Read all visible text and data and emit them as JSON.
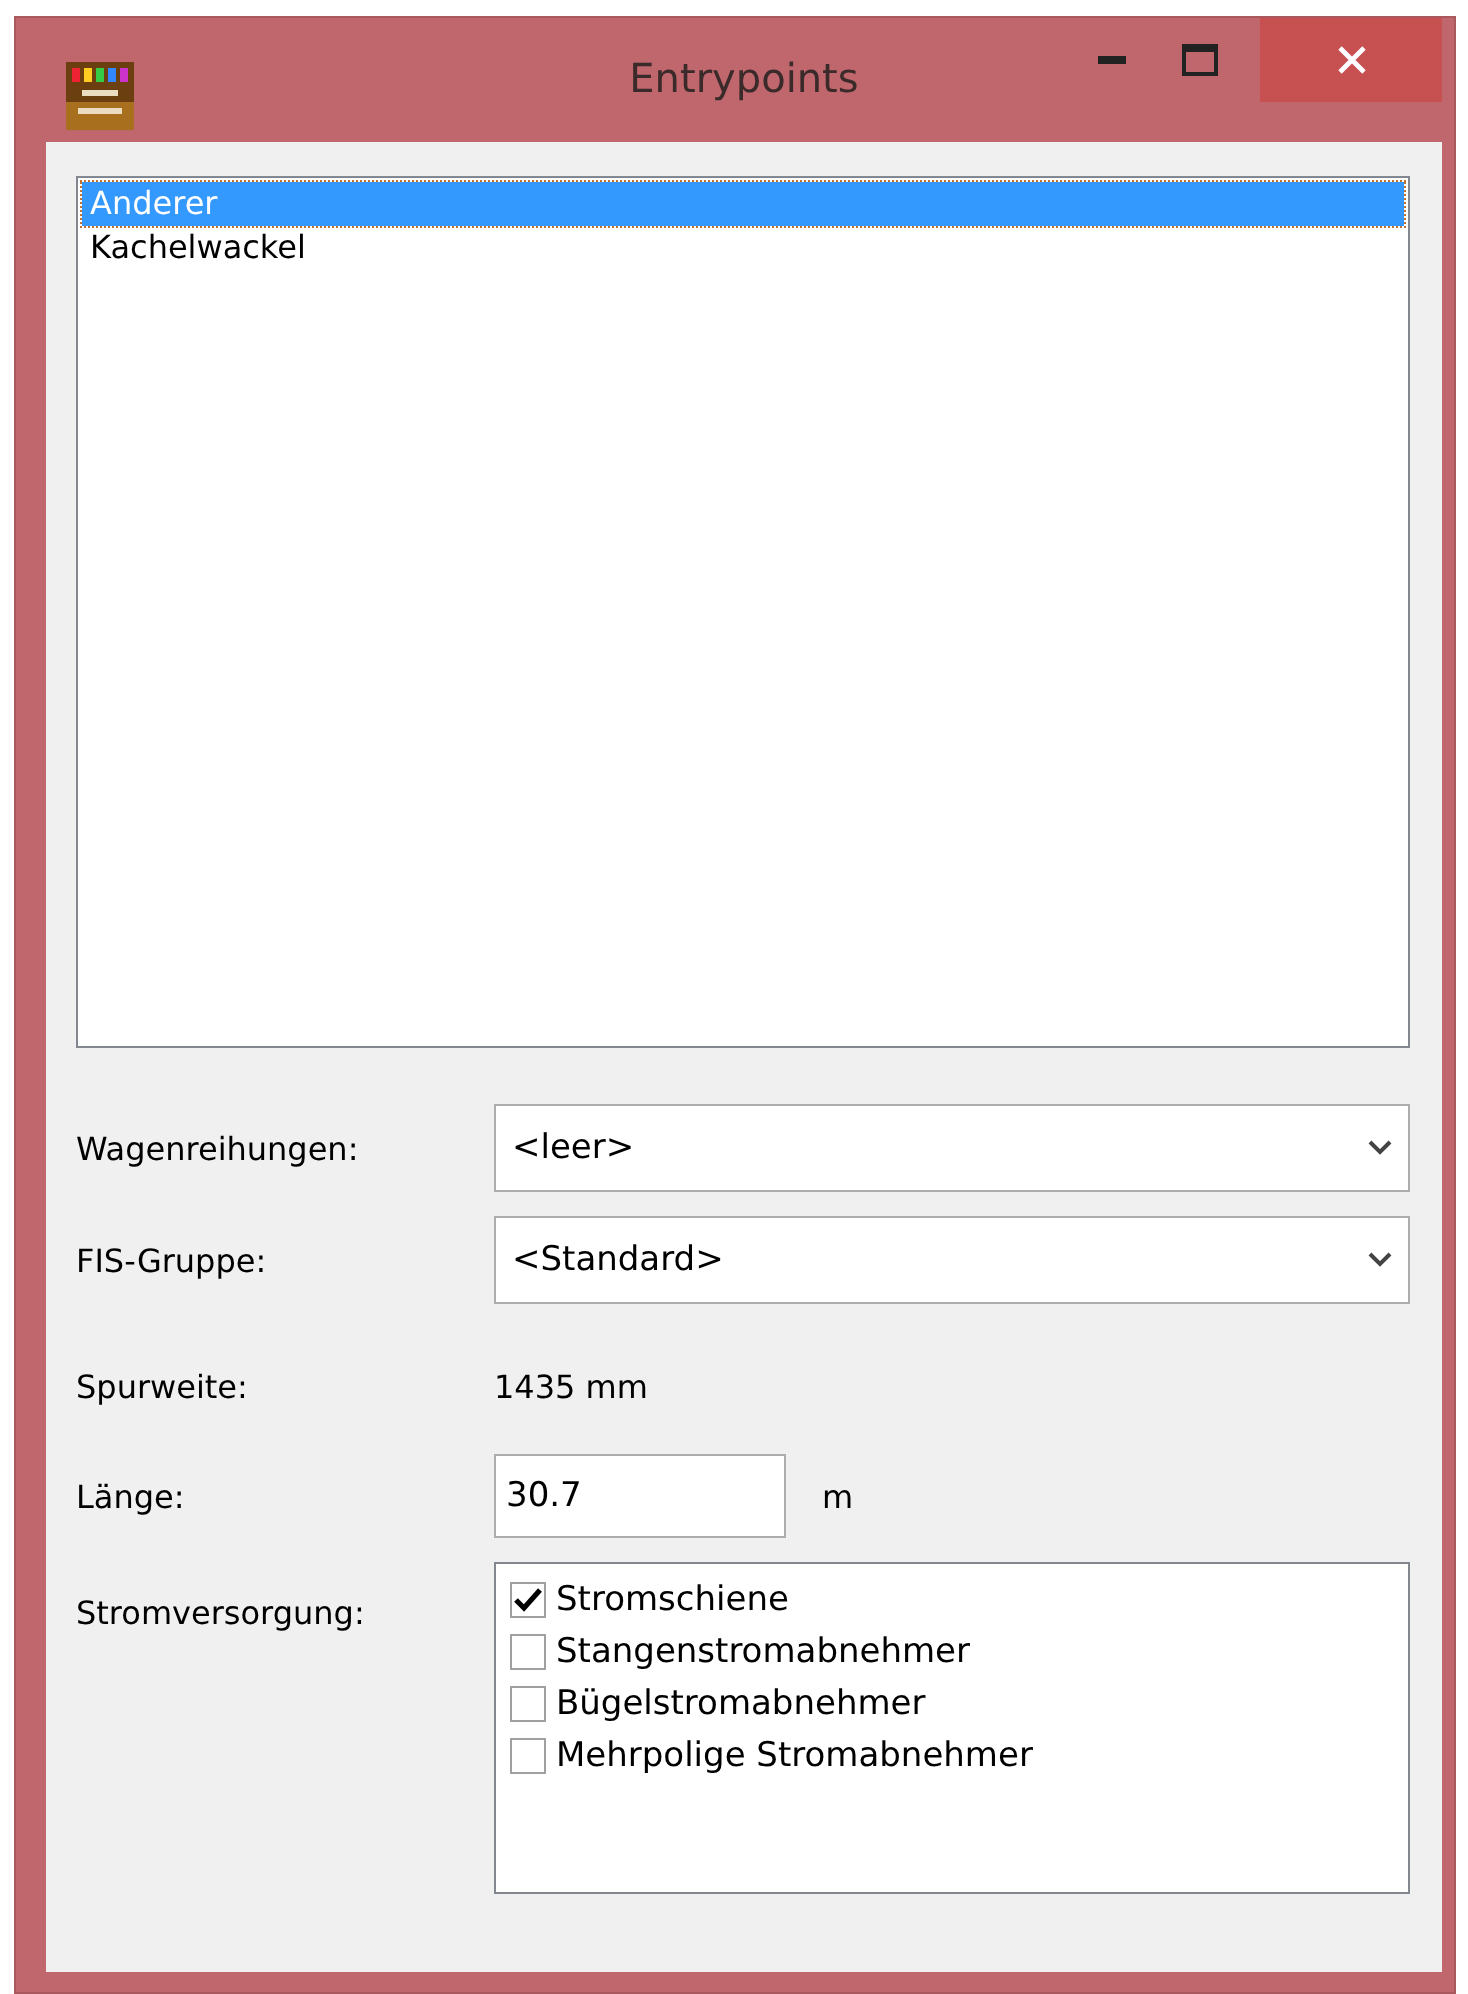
{
  "window": {
    "title": "Entrypoints"
  },
  "entries": [
    {
      "label": "Anderer",
      "selected": true
    },
    {
      "label": "Kachelwackel",
      "selected": false
    }
  ],
  "form": {
    "wagenreihungen": {
      "label": "Wagenreihungen:",
      "value": "<leer>"
    },
    "fis_gruppe": {
      "label": "FIS-Gruppe:",
      "value": "<Standard>"
    },
    "spurweite": {
      "label": "Spurweite:",
      "value": "1435 mm"
    },
    "laenge": {
      "label": "Länge:",
      "value": "30.7",
      "unit": "m"
    },
    "stromversorgung": {
      "label": "Stromversorgung:",
      "options": [
        {
          "label": "Stromschiene",
          "checked": true
        },
        {
          "label": "Stangenstromabnehmer",
          "checked": false
        },
        {
          "label": "Bügelstromabnehmer",
          "checked": false
        },
        {
          "label": "Mehrpolige Stromabnehmer",
          "checked": false
        }
      ]
    }
  }
}
